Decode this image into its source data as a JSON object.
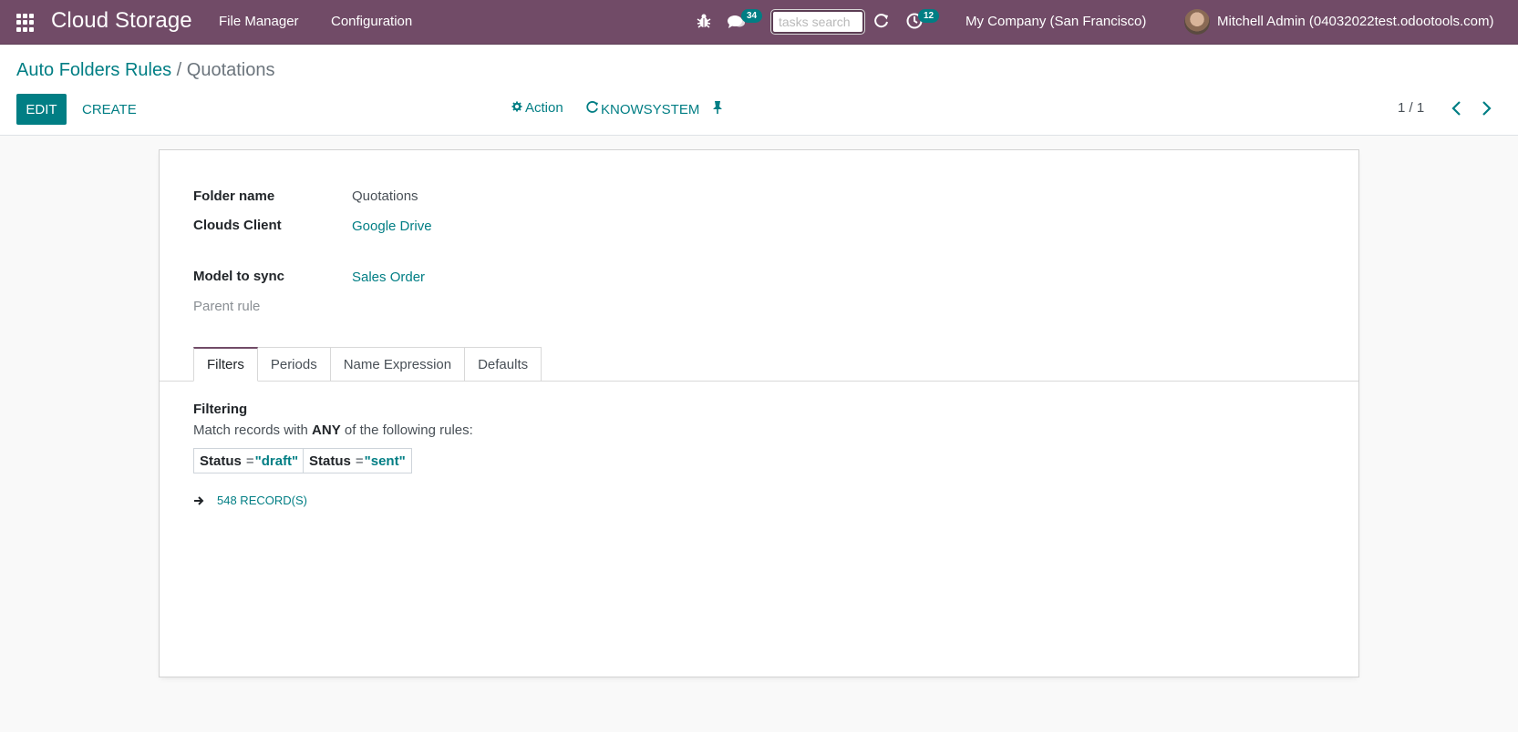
{
  "navbar": {
    "app_name": "Cloud Storage",
    "menus": [
      "File Manager",
      "Configuration"
    ],
    "chat_badge": "34",
    "activity_badge": "12",
    "search_placeholder": "tasks search",
    "company": "My Company (San Francisco)",
    "user": "Mitchell Admin (04032022test.odootools.com)",
    "brand_color": "#714b67",
    "icons": [
      "apps-grid-icon",
      "bug-icon",
      "chat-icon",
      "refresh-icon",
      "activity-clock-icon"
    ]
  },
  "breadcrumb": {
    "parent": "Auto Folders Rules",
    "separator": "/",
    "current": "Quotations"
  },
  "control_panel": {
    "edit_label": "EDIT",
    "create_label": "CREATE",
    "action_label": "Action",
    "knowsystem_label": "KNOWSYSTEM",
    "pager": "1 / 1",
    "accent_color": "#017e84"
  },
  "form": {
    "folder_name_label": "Folder name",
    "folder_name_value": "Quotations",
    "clouds_client_label": "Clouds Client",
    "clouds_client_value": "Google Drive",
    "model_label": "Model to sync",
    "model_value": "Sales Order",
    "parent_rule_label": "Parent rule"
  },
  "tabs": [
    {
      "label": "Filters",
      "active": true
    },
    {
      "label": "Periods",
      "active": false
    },
    {
      "label": "Name Expression",
      "active": false
    },
    {
      "label": "Defaults",
      "active": false
    }
  ],
  "filters": {
    "title": "Filtering",
    "desc_prefix": "Match records with",
    "desc_any": "ANY",
    "desc_suffix": "of the following rules:",
    "rules": [
      {
        "field": "Status",
        "operator": "=",
        "value": "\"draft\""
      },
      {
        "field": "Status",
        "operator": "=",
        "value": "\"sent\""
      }
    ],
    "records_label": "548 RECORD(S)"
  }
}
